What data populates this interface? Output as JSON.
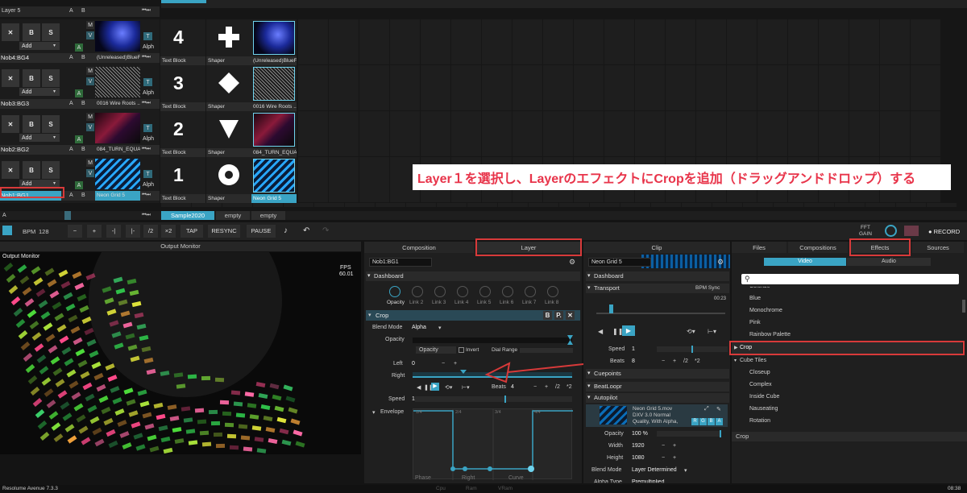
{
  "top_layer_label": "Layer 5",
  "layers": [
    {
      "name": "Nob4:BG4",
      "add": "Add",
      "clip_name": "(Unreleased)BlueF...",
      "selected": false
    },
    {
      "name": "Nob3:BG3",
      "add": "Add",
      "clip_name": "0016 Wire Roots ...",
      "selected": false
    },
    {
      "name": "Nob2:BG2",
      "add": "Add",
      "clip_name": "084_TURN_EQUAL...",
      "selected": false
    },
    {
      "name": "Nob1:BG1",
      "add": "Add",
      "clip_name": "Neon Grid 5",
      "selected": true
    }
  ],
  "layer_buttons": {
    "x": "✕",
    "b": "B",
    "s": "S",
    "m": "M",
    "v": "V",
    "a": "A",
    "t": "T",
    "alph": "Alph"
  },
  "clip_columns": [
    {
      "num": "4",
      "text_block": "Text Block",
      "shaper": "Shaper",
      "shape": "cross",
      "clip": "(Unreleased)BlueF..."
    },
    {
      "num": "3",
      "text_block": "Text Block",
      "shaper": "Shaper",
      "shape": "diamond",
      "clip": "0016 Wire Roots ..."
    },
    {
      "num": "2",
      "text_block": "Text Block",
      "shaper": "Shaper",
      "shape": "triangle",
      "clip": "084_TURN_EQUAL..."
    },
    {
      "num": "1",
      "text_block": "Text Block",
      "shaper": "Shaper",
      "shape": "circle",
      "clip": "Neon Grid 5"
    }
  ],
  "annotation": "Layer１を選択し、LayerのエフェクトにCropを追加（ドラッグアンドドロップ）する",
  "deck_tabs": [
    "Sample2020",
    "empty",
    "empty"
  ],
  "bottom_a": "A",
  "toolbar": {
    "bpm_label": "BPM",
    "bpm_value": "128",
    "minus": "−",
    "plus": "+",
    "nudge_left": "-|",
    "nudge_right": "|-",
    "half": "/2",
    "double": "×2",
    "tap": "TAP",
    "resync": "RESYNC",
    "pause": "PAUSE",
    "fft": "FFT",
    "gain": "GAIN",
    "record": "● RECORD"
  },
  "output_monitor": {
    "header": "Output Monitor",
    "title": "Output Monitor",
    "fps_label": "FPS",
    "fps_value": "60.01"
  },
  "composition_tab": "Composition",
  "layer_tab": "Layer",
  "clip_tab": "Clip",
  "layer_panel": {
    "name": "Nob1:BG1",
    "dashboard": "Dashboard",
    "links": [
      "Opacity",
      "Link 2",
      "Link 3",
      "Link 4",
      "Link 5",
      "Link 6",
      "Link 7",
      "Link 8"
    ],
    "crop_title": "Crop",
    "crop_btns": [
      "B",
      "P.",
      "✕"
    ],
    "blend_mode_label": "Blend Mode",
    "blend_mode_value": "Alpha",
    "opacity_label": "Opacity",
    "opacity_dropdown": "Opacity",
    "invert": "Invert",
    "dial_range": "Dial Range",
    "left_label": "Left",
    "left_value": "0",
    "right_label": "Right",
    "beats_label": "Beats",
    "beats_value": "4",
    "half": "/2",
    "double": "*2",
    "speed_label": "Speed",
    "speed_value": "1",
    "envelope_label": "Envelope",
    "env_ticks": [
      "1/4",
      "2/4",
      "3/4",
      "4/4"
    ],
    "env_bottom": [
      "Phase",
      "Right",
      "Curve"
    ]
  },
  "clip_panel": {
    "name": "Neon Grid 5",
    "dashboard": "Dashboard",
    "transport": "Transport",
    "bpm_sync": "BPM Sync",
    "time": "00:23",
    "speed_label": "Speed",
    "speed_value": "1",
    "beats_label": "Beats",
    "beats_value": "8",
    "half": "/2",
    "double": "*2",
    "cuepoints": "Cuepoints",
    "beatloopr": "BeatLoopr",
    "autopilot": "Autopilot",
    "file_name": "Neon Grid 5.mov",
    "file_codec": "DXV 3.0 Normal",
    "file_quality": "Quality, With Alpha,",
    "rgba": [
      "R",
      "G",
      "B",
      "A"
    ],
    "opacity_label": "Opacity",
    "opacity_value": "100 %",
    "width_label": "Width",
    "width_value": "1920",
    "height_label": "Height",
    "height_value": "1080",
    "blend_label": "Blend Mode",
    "blend_value": "Layer Determined",
    "alpha_label": "Alpha Type",
    "alpha_value": "Premultiplied"
  },
  "browser": {
    "tabs": [
      "Files",
      "Compositions",
      "Effects",
      "Sources"
    ],
    "sub_tabs": [
      "Video",
      "Audio"
    ],
    "search_placeholder": "",
    "items_top": [
      "Colorize",
      "Blue",
      "Monochrome",
      "Pink",
      "Rainbow Palette"
    ],
    "crop": "Crop",
    "cube_tiles": "Cube Tiles",
    "items_bottom": [
      "Closeup",
      "Complex",
      "Inside Cube",
      "Nauseating",
      "Rotation"
    ],
    "preview_title": "Crop"
  },
  "statusbar": {
    "app": "Resolume Avenue 7.3.3",
    "cpu": "Cpu",
    "ram": "Ram",
    "vram": "VRam",
    "time": "08:38"
  },
  "colors": {
    "accent": "#3aa4c4",
    "red": "#d83a3a",
    "annotation": "#e8344a"
  }
}
